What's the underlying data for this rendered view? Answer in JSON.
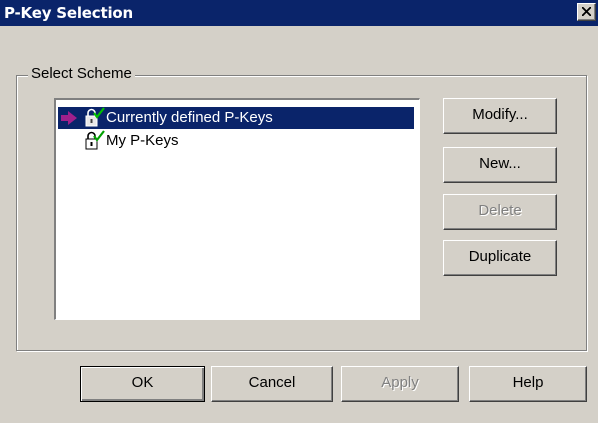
{
  "window": {
    "title": "P-Key Selection"
  },
  "group": {
    "label": "Select Scheme"
  },
  "schemes": [
    {
      "label": "Currently defined P-Keys",
      "selected": true
    },
    {
      "label": "My P-Keys",
      "selected": false
    }
  ],
  "side_buttons": {
    "modify": "Modify...",
    "new": "New...",
    "delete": "Delete",
    "duplicate": "Duplicate"
  },
  "footer_buttons": {
    "ok": "OK",
    "cancel": "Cancel",
    "apply": "Apply",
    "help": "Help"
  },
  "colors": {
    "selection": "#0a246a",
    "arrow": "#a0208c",
    "check": "#00a000"
  },
  "icons": {
    "close": "close-icon",
    "current_marker": "arrow-right-icon",
    "scheme": "padlock-check-icon"
  }
}
